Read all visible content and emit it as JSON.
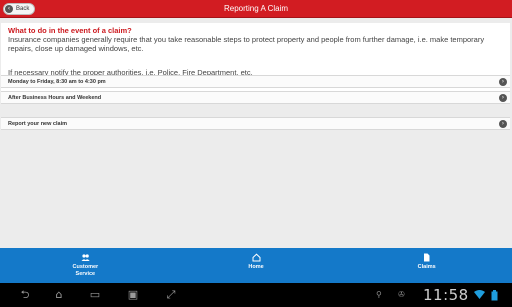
{
  "header": {
    "title": "Reporting A Claim",
    "back_label": "Back"
  },
  "info": {
    "heading": "What to do in the event of a claim?",
    "body": "Insurance companies generally require that you take reasonable steps to protect property and people from further damage, i.e. make temporary repairs, close up damaged windows, etc.",
    "note": "If necessary notify the proper authorities, i.e. Police, Fire Department, etc."
  },
  "rows": [
    {
      "label": "Monday to Friday, 8:30 am to 4:30 pm"
    },
    {
      "label": "After Business Hours and Weekend"
    },
    {
      "label": "Report your new claim"
    }
  ],
  "bottom_nav": [
    {
      "label": "Customer Service",
      "icon": "people-icon"
    },
    {
      "label": "Home",
      "icon": "home-icon"
    },
    {
      "label": "Claims",
      "icon": "document-icon"
    }
  ],
  "system_bar": {
    "time": "11:58",
    "accent": "#1479c9"
  },
  "colors": {
    "header": "#d21c22",
    "heading_red": "#cc1a1f",
    "nav_blue": "#1479c9"
  }
}
